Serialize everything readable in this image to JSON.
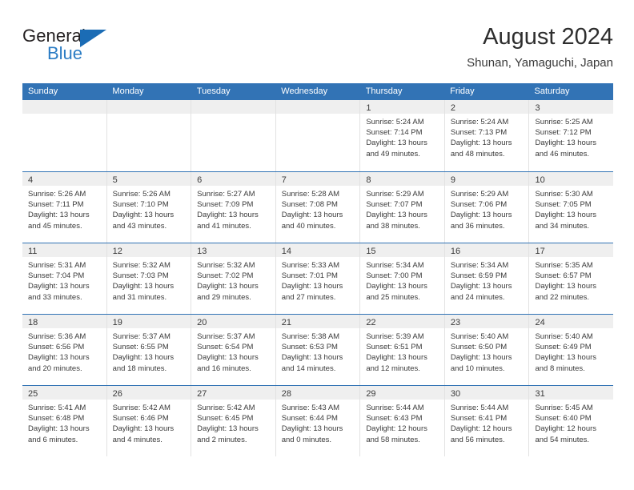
{
  "brand": {
    "name_part1": "General",
    "name_part2": "Blue",
    "accent_color": "#1b6cb5"
  },
  "header": {
    "title": "August 2024",
    "subtitle": "Shunan, Yamaguchi, Japan"
  },
  "calendar": {
    "header_color": "#3273b5",
    "weekdays": [
      "Sunday",
      "Monday",
      "Tuesday",
      "Wednesday",
      "Thursday",
      "Friday",
      "Saturday"
    ],
    "weeks": [
      [
        {
          "day": "",
          "empty": true
        },
        {
          "day": "",
          "empty": true
        },
        {
          "day": "",
          "empty": true
        },
        {
          "day": "",
          "empty": true
        },
        {
          "day": "1",
          "sunrise": "Sunrise: 5:24 AM",
          "sunset": "Sunset: 7:14 PM",
          "daylight1": "Daylight: 13 hours",
          "daylight2": "and 49 minutes."
        },
        {
          "day": "2",
          "sunrise": "Sunrise: 5:24 AM",
          "sunset": "Sunset: 7:13 PM",
          "daylight1": "Daylight: 13 hours",
          "daylight2": "and 48 minutes."
        },
        {
          "day": "3",
          "sunrise": "Sunrise: 5:25 AM",
          "sunset": "Sunset: 7:12 PM",
          "daylight1": "Daylight: 13 hours",
          "daylight2": "and 46 minutes."
        }
      ],
      [
        {
          "day": "4",
          "sunrise": "Sunrise: 5:26 AM",
          "sunset": "Sunset: 7:11 PM",
          "daylight1": "Daylight: 13 hours",
          "daylight2": "and 45 minutes."
        },
        {
          "day": "5",
          "sunrise": "Sunrise: 5:26 AM",
          "sunset": "Sunset: 7:10 PM",
          "daylight1": "Daylight: 13 hours",
          "daylight2": "and 43 minutes."
        },
        {
          "day": "6",
          "sunrise": "Sunrise: 5:27 AM",
          "sunset": "Sunset: 7:09 PM",
          "daylight1": "Daylight: 13 hours",
          "daylight2": "and 41 minutes."
        },
        {
          "day": "7",
          "sunrise": "Sunrise: 5:28 AM",
          "sunset": "Sunset: 7:08 PM",
          "daylight1": "Daylight: 13 hours",
          "daylight2": "and 40 minutes."
        },
        {
          "day": "8",
          "sunrise": "Sunrise: 5:29 AM",
          "sunset": "Sunset: 7:07 PM",
          "daylight1": "Daylight: 13 hours",
          "daylight2": "and 38 minutes."
        },
        {
          "day": "9",
          "sunrise": "Sunrise: 5:29 AM",
          "sunset": "Sunset: 7:06 PM",
          "daylight1": "Daylight: 13 hours",
          "daylight2": "and 36 minutes."
        },
        {
          "day": "10",
          "sunrise": "Sunrise: 5:30 AM",
          "sunset": "Sunset: 7:05 PM",
          "daylight1": "Daylight: 13 hours",
          "daylight2": "and 34 minutes."
        }
      ],
      [
        {
          "day": "11",
          "sunrise": "Sunrise: 5:31 AM",
          "sunset": "Sunset: 7:04 PM",
          "daylight1": "Daylight: 13 hours",
          "daylight2": "and 33 minutes."
        },
        {
          "day": "12",
          "sunrise": "Sunrise: 5:32 AM",
          "sunset": "Sunset: 7:03 PM",
          "daylight1": "Daylight: 13 hours",
          "daylight2": "and 31 minutes."
        },
        {
          "day": "13",
          "sunrise": "Sunrise: 5:32 AM",
          "sunset": "Sunset: 7:02 PM",
          "daylight1": "Daylight: 13 hours",
          "daylight2": "and 29 minutes."
        },
        {
          "day": "14",
          "sunrise": "Sunrise: 5:33 AM",
          "sunset": "Sunset: 7:01 PM",
          "daylight1": "Daylight: 13 hours",
          "daylight2": "and 27 minutes."
        },
        {
          "day": "15",
          "sunrise": "Sunrise: 5:34 AM",
          "sunset": "Sunset: 7:00 PM",
          "daylight1": "Daylight: 13 hours",
          "daylight2": "and 25 minutes."
        },
        {
          "day": "16",
          "sunrise": "Sunrise: 5:34 AM",
          "sunset": "Sunset: 6:59 PM",
          "daylight1": "Daylight: 13 hours",
          "daylight2": "and 24 minutes."
        },
        {
          "day": "17",
          "sunrise": "Sunrise: 5:35 AM",
          "sunset": "Sunset: 6:57 PM",
          "daylight1": "Daylight: 13 hours",
          "daylight2": "and 22 minutes."
        }
      ],
      [
        {
          "day": "18",
          "sunrise": "Sunrise: 5:36 AM",
          "sunset": "Sunset: 6:56 PM",
          "daylight1": "Daylight: 13 hours",
          "daylight2": "and 20 minutes."
        },
        {
          "day": "19",
          "sunrise": "Sunrise: 5:37 AM",
          "sunset": "Sunset: 6:55 PM",
          "daylight1": "Daylight: 13 hours",
          "daylight2": "and 18 minutes."
        },
        {
          "day": "20",
          "sunrise": "Sunrise: 5:37 AM",
          "sunset": "Sunset: 6:54 PM",
          "daylight1": "Daylight: 13 hours",
          "daylight2": "and 16 minutes."
        },
        {
          "day": "21",
          "sunrise": "Sunrise: 5:38 AM",
          "sunset": "Sunset: 6:53 PM",
          "daylight1": "Daylight: 13 hours",
          "daylight2": "and 14 minutes."
        },
        {
          "day": "22",
          "sunrise": "Sunrise: 5:39 AM",
          "sunset": "Sunset: 6:51 PM",
          "daylight1": "Daylight: 13 hours",
          "daylight2": "and 12 minutes."
        },
        {
          "day": "23",
          "sunrise": "Sunrise: 5:40 AM",
          "sunset": "Sunset: 6:50 PM",
          "daylight1": "Daylight: 13 hours",
          "daylight2": "and 10 minutes."
        },
        {
          "day": "24",
          "sunrise": "Sunrise: 5:40 AM",
          "sunset": "Sunset: 6:49 PM",
          "daylight1": "Daylight: 13 hours",
          "daylight2": "and 8 minutes."
        }
      ],
      [
        {
          "day": "25",
          "sunrise": "Sunrise: 5:41 AM",
          "sunset": "Sunset: 6:48 PM",
          "daylight1": "Daylight: 13 hours",
          "daylight2": "and 6 minutes."
        },
        {
          "day": "26",
          "sunrise": "Sunrise: 5:42 AM",
          "sunset": "Sunset: 6:46 PM",
          "daylight1": "Daylight: 13 hours",
          "daylight2": "and 4 minutes."
        },
        {
          "day": "27",
          "sunrise": "Sunrise: 5:42 AM",
          "sunset": "Sunset: 6:45 PM",
          "daylight1": "Daylight: 13 hours",
          "daylight2": "and 2 minutes."
        },
        {
          "day": "28",
          "sunrise": "Sunrise: 5:43 AM",
          "sunset": "Sunset: 6:44 PM",
          "daylight1": "Daylight: 13 hours",
          "daylight2": "and 0 minutes."
        },
        {
          "day": "29",
          "sunrise": "Sunrise: 5:44 AM",
          "sunset": "Sunset: 6:43 PM",
          "daylight1": "Daylight: 12 hours",
          "daylight2": "and 58 minutes."
        },
        {
          "day": "30",
          "sunrise": "Sunrise: 5:44 AM",
          "sunset": "Sunset: 6:41 PM",
          "daylight1": "Daylight: 12 hours",
          "daylight2": "and 56 minutes."
        },
        {
          "day": "31",
          "sunrise": "Sunrise: 5:45 AM",
          "sunset": "Sunset: 6:40 PM",
          "daylight1": "Daylight: 12 hours",
          "daylight2": "and 54 minutes."
        }
      ]
    ]
  }
}
